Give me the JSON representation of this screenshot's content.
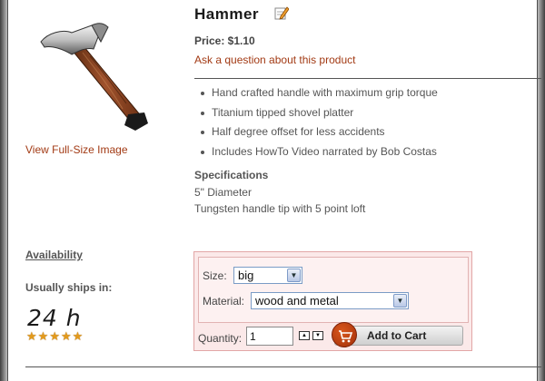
{
  "product": {
    "title": "Hammer",
    "price": "Price: $1.10",
    "ask_link": "Ask a question about this product",
    "fullsize_link": "View Full-Size Image",
    "features": [
      "Hand crafted handle with maximum grip torque",
      "Titanium tipped shovel platter",
      "Half degree offset for less accidents",
      "Includes HowTo Video narrated by Bob Costas"
    ],
    "specifications": {
      "heading": "Specifications",
      "lines": [
        "5\" Diameter",
        "Tungsten handle tip with 5 point loft"
      ]
    }
  },
  "availability": {
    "heading": "Availability",
    "ships_label": "Usually ships in:",
    "ship_time": "24 h",
    "rating_stars": 5
  },
  "options": {
    "size_label": "Size:",
    "size_value": "big",
    "material_label": "Material:",
    "material_value": "wood and metal",
    "quantity_label": "Quantity:",
    "quantity_value": "1",
    "add_to_cart_label": "Add to Cart"
  },
  "colors": {
    "link": "#a23a14",
    "option_box_bg": "#fbe9e9",
    "option_box_border": "#e2a6a6",
    "star": "#e39a1c"
  },
  "icons": {
    "edit": "edit-pencil-icon",
    "cart": "cart-icon",
    "star": "star-icon"
  }
}
